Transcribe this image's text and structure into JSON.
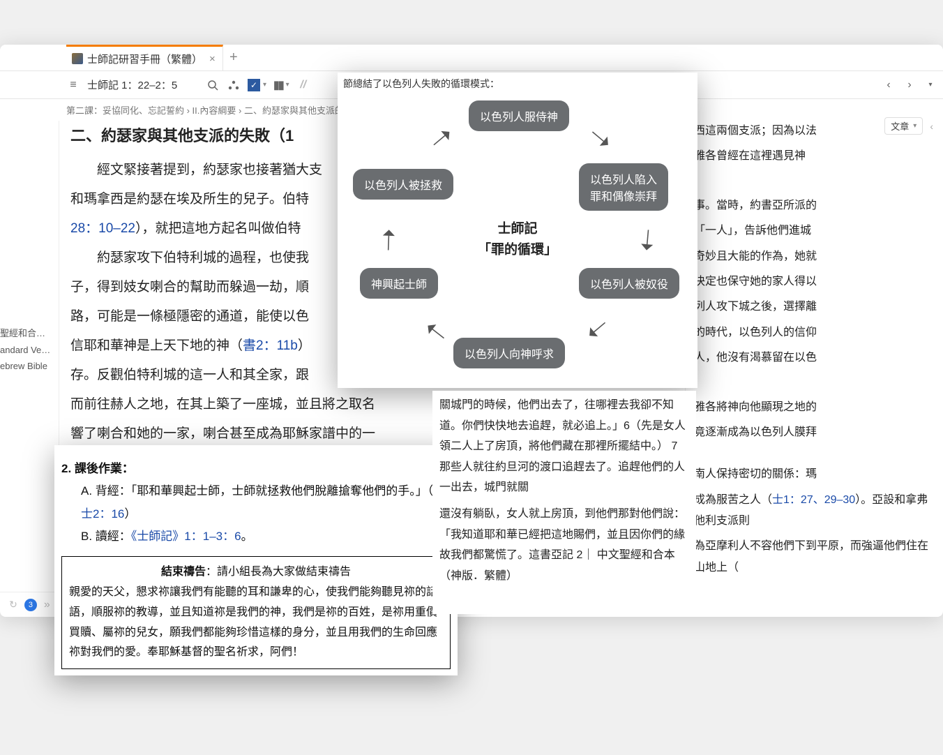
{
  "tab": {
    "title": "士師記研習手冊（繁體）",
    "close": "×",
    "add": "+"
  },
  "toolbar": {
    "ref": "士師記 1：22–2：5",
    "nav_back": "‹",
    "nav_fwd": "›",
    "article_label": "文章"
  },
  "breadcrumb": "第二課：妥協同化、忘記誓約 › II.內容綱要 › 二、約瑟家與其他支派的失敗",
  "left_rail": {
    "a": "聖經和合…",
    "b": "andard Ve…",
    "c": "ebrew Bible"
  },
  "badge_count": "3",
  "heading": "二、約瑟家與其他支派的失敗（1",
  "para1a": "經文緊接著提到，約瑟家也接著猶大支",
  "para1b": "和瑪拿西是約瑟在埃及所生的兒子。伯特",
  "ref1": "28：10–22",
  "para1c": "），就把這地方起名叫做伯特",
  "para2a": "約瑟家攻下伯特利城的過程，也使我",
  "para2b": "子，得到妓女喇合的幫助而躲過一劫，順",
  "para2c": "路，可能是一條極隱密的通道，能使以色",
  "para2d_pre": "信耶和華神是上天下地的神（",
  "ref2": "書2：11b",
  "para2d_post": "）",
  "para2e": "存。反觀伯特利城的這一人和其全家，跟",
  "para2f": "而前往赫人之地，在其上築了一座城，並且將之取名",
  "para2g": "響了喇合和她的一家，喇合甚至成為耶穌家譜中的一",
  "right": {
    "r1": "西這兩個支派；因為以法",
    "r2": "雅各曾經在這裡遇見神",
    "r3": "事。當時，約書亞所派的",
    "r4": "「一人」，告訴他們進城",
    "r5": "奇妙且大能的作為，她就",
    "r6": "決定也保守她的家人得以",
    "r7": "列人攻下城之後，選擇離",
    "r8": "的時代，以色列人的信仰",
    "r9": "人，他沒有渴慕留在以色",
    "r10": "雅各將神向他顯現之地的",
    "r11": "竟逐漸成為以色列人膜拜",
    "r12_pre": "南人保持密切的關係：瑪",
    "r13_pre": "成為服苦之人（",
    "r13_ref": "士1：27、29–30",
    "r13_post": "）。亞設和拿弗他利支派則",
    "r14": "為亞摩利人不容他們下到平原，而強逼他們住在山地上（"
  },
  "cycle": {
    "caption": "節總結了以色列人失敗的循環模式：",
    "center_l1": "士師記",
    "center_l2": "「罪的循環」",
    "n_top": "以色列人服侍神",
    "n_tr": "以色列人陷入\n罪和偶像崇拜",
    "n_r": "以色列人被奴役",
    "n_b": "以色列人向神呼求",
    "n_l": "神興起士師",
    "n_tl": "以色列人被拯救"
  },
  "hw": {
    "title": "2. 課後作業：",
    "a_pre": "背經：「耶和華興起士師，士師就拯救他們脫離搶奪他們的手。」（",
    "a_ref": "士2：16",
    "a_post": "）",
    "b_pre": "讀經：",
    "b_ref": "《士師記》1：1–3：6",
    "b_post": "。",
    "box_title": "結束禱告",
    "box_lead": "：請小組長為大家做結束禱告",
    "box_body": "親愛的天父，懇求祢讓我們有能聽的耳和謙卑的心，使我們能夠聽見祢的話語，順服祢的教導，並且知道祢是我們的神，我們是祢的百姓，是祢用重價買贖、屬祢的兒女，願我們都能夠珍惜這樣的身分，並且用我們的生命回應祢對我們的愛。奉耶穌基督的聖名祈求，阿們！"
  },
  "passage": {
    "p1": "關城門的時候，他們出去了，往哪裡去我卻不知道。你們快快地去追趕，就必追上。」6（先是女人領二人上了房頂，將他們藏在那裡所擺結中。） 7 那些人就往約旦河的渡口追趕去了。追趕他們的人一出去，城門就關",
    "p2": "還沒有躺臥，女人就上房頂，到他們那對他們說：「我知道耶和華已經把這地賜們，並且因你們的緣故我們都驚慌了。這書亞記 2｜ 中文聖經和合本（神版．繁體）"
  }
}
